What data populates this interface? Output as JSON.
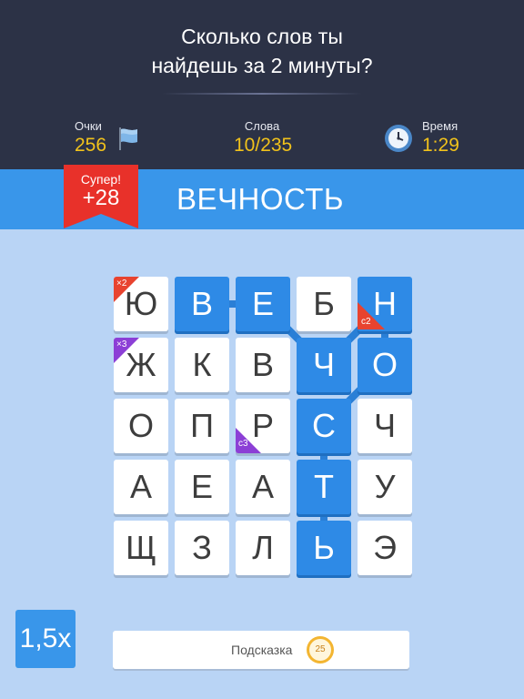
{
  "header": {
    "question_line1": "Сколько слов ты",
    "question_line2": "найдешь за 2 минуты?"
  },
  "stats": {
    "score": {
      "label": "Очки",
      "value": "256"
    },
    "words": {
      "label": "Слова",
      "value": "10/235"
    },
    "time": {
      "label": "Время",
      "value": "1:29"
    }
  },
  "bonus": {
    "label": "Супер!",
    "value": "+28"
  },
  "current_word": "ВЕЧНОСТЬ",
  "board": {
    "rows": [
      [
        "Ю",
        "В",
        "Е",
        "Б",
        "Н"
      ],
      [
        "Ж",
        "К",
        "В",
        "Ч",
        "О"
      ],
      [
        "О",
        "П",
        "Р",
        "С",
        "Ч"
      ],
      [
        "А",
        "Е",
        "А",
        "Т",
        "У"
      ],
      [
        "Щ",
        "З",
        "Л",
        "Ь",
        "Э"
      ]
    ],
    "path": [
      [
        0,
        1
      ],
      [
        0,
        2
      ],
      [
        1,
        3
      ],
      [
        0,
        4
      ],
      [
        1,
        4
      ],
      [
        2,
        3
      ],
      [
        3,
        3
      ],
      [
        4,
        3
      ]
    ],
    "bonuses": [
      {
        "row": 0,
        "col": 0,
        "text": "×2",
        "color": "#e8432f"
      },
      {
        "row": 1,
        "col": 0,
        "text": "×3",
        "color": "#8c3fd6"
      },
      {
        "row": 0,
        "col": 4,
        "text": "c2",
        "color": "#e8432f"
      },
      {
        "row": 2,
        "col": 2,
        "text": "c3",
        "color": "#8c3fd6"
      }
    ]
  },
  "multiplier": "1,5x",
  "hint": {
    "label": "Подсказка",
    "cost": "25"
  },
  "colors": {
    "accent": "#3996ea",
    "selected_tile": "#2e8ae6",
    "gold": "#f1c21b",
    "ribbon": "#e8312a",
    "header_bg": "#2c3246",
    "board_bg": "#b9d4f5"
  },
  "icons": {
    "score": "flag-icon",
    "time": "clock-icon",
    "hint_cost": "coin-icon"
  }
}
